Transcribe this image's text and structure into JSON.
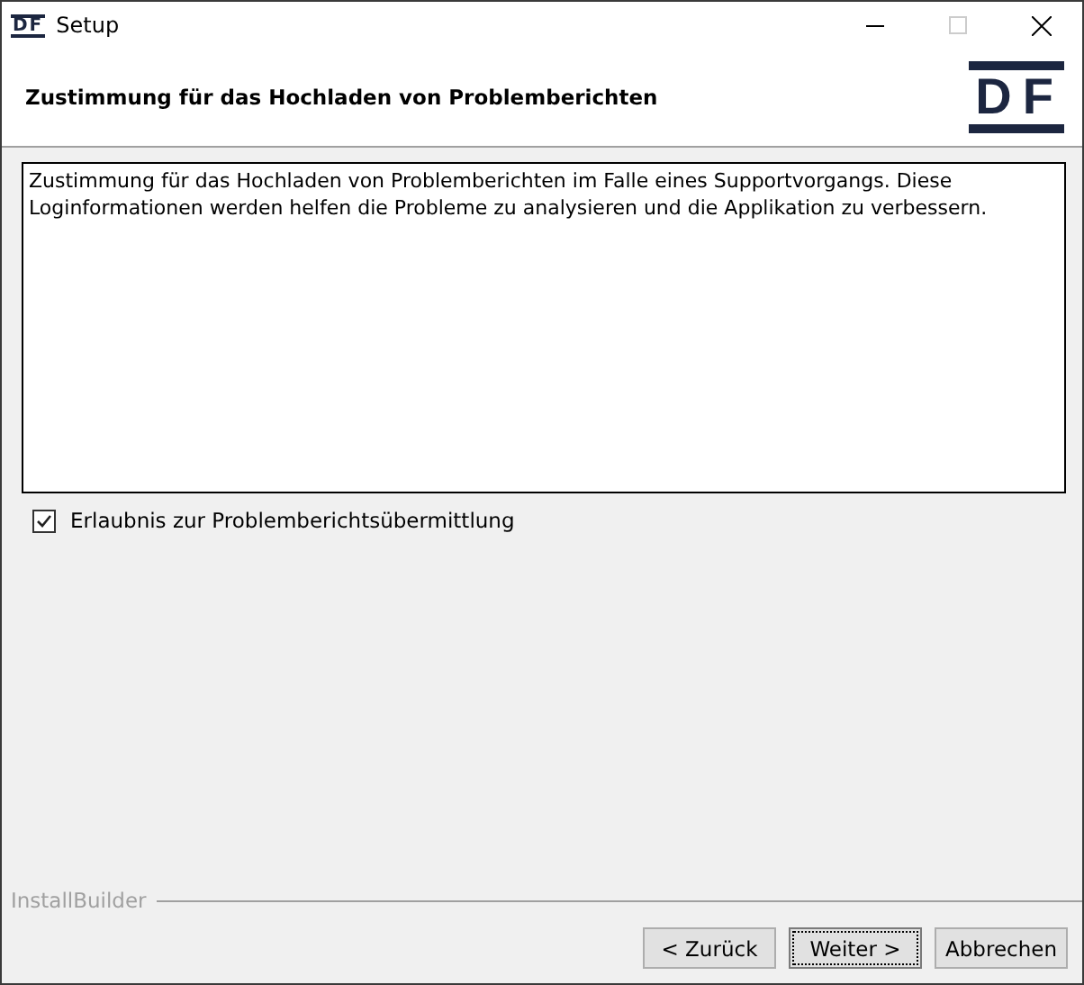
{
  "window": {
    "icon_text": "DF",
    "title": "Setup"
  },
  "header": {
    "title": "Zustimmung für das Hochladen von Problemberichten",
    "logo_text": "DF"
  },
  "message": "Zustimmung für das Hochladen von Problemberichten im Falle eines Supportvorgangs. Diese Loginformationen werden helfen die Probleme zu analysieren und die Applikation zu verbessern.",
  "consent": {
    "label": "Erlaubnis zur Problemberichtsübermittlung",
    "checked": true
  },
  "footer": {
    "brand": "InstallBuilder"
  },
  "buttons": [
    {
      "label": "< Zurück",
      "focused": false
    },
    {
      "label": "Weiter >",
      "focused": true
    },
    {
      "label": "Abbrechen",
      "focused": false
    }
  ]
}
